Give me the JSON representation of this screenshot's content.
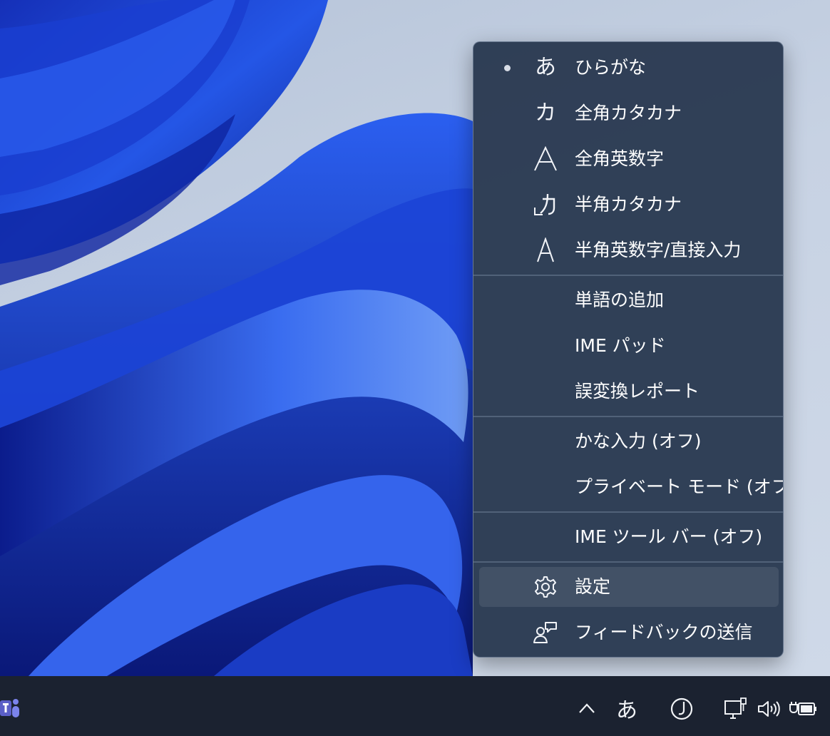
{
  "menu": {
    "items": [
      {
        "label": "ひらがな",
        "glyph": "あ",
        "icon": "hiragana-icon",
        "selected": true
      },
      {
        "label": "全角カタカナ",
        "glyph": "カ",
        "icon": "fullwidth-katakana-icon"
      },
      {
        "label": "全角英数字",
        "glyph": "A",
        "icon": "fullwidth-alphanumeric-icon"
      },
      {
        "label": "半角カタカナ",
        "glyph": "_カ",
        "icon": "halfwidth-katakana-icon"
      },
      {
        "label": "半角英数字/直接入力",
        "glyph": "A",
        "icon": "halfwidth-alphanumeric-icon"
      },
      {
        "label": "単語の追加"
      },
      {
        "label": "IME パッド"
      },
      {
        "label": "誤変換レポート"
      },
      {
        "label": "かな入力 (オフ)"
      },
      {
        "label": "プライベート モード (オフ)"
      },
      {
        "label": "IME ツール バー (オフ)"
      },
      {
        "label": "設定",
        "icon": "gear-icon",
        "hovered": true
      },
      {
        "label": "フィードバックの送信",
        "icon": "feedback-icon"
      }
    ]
  },
  "taskbar": {
    "ime_mode": "あ",
    "icons": [
      "teams-icon",
      "chevron-up-icon",
      "ime-mode-icon",
      "ime-status-icon",
      "network-icon",
      "volume-icon",
      "battery-icon"
    ]
  },
  "colors": {
    "menu_bg": "#26364e",
    "taskbar_bg": "#1b2230",
    "wallpaper_accent": "#1e3fc4"
  }
}
